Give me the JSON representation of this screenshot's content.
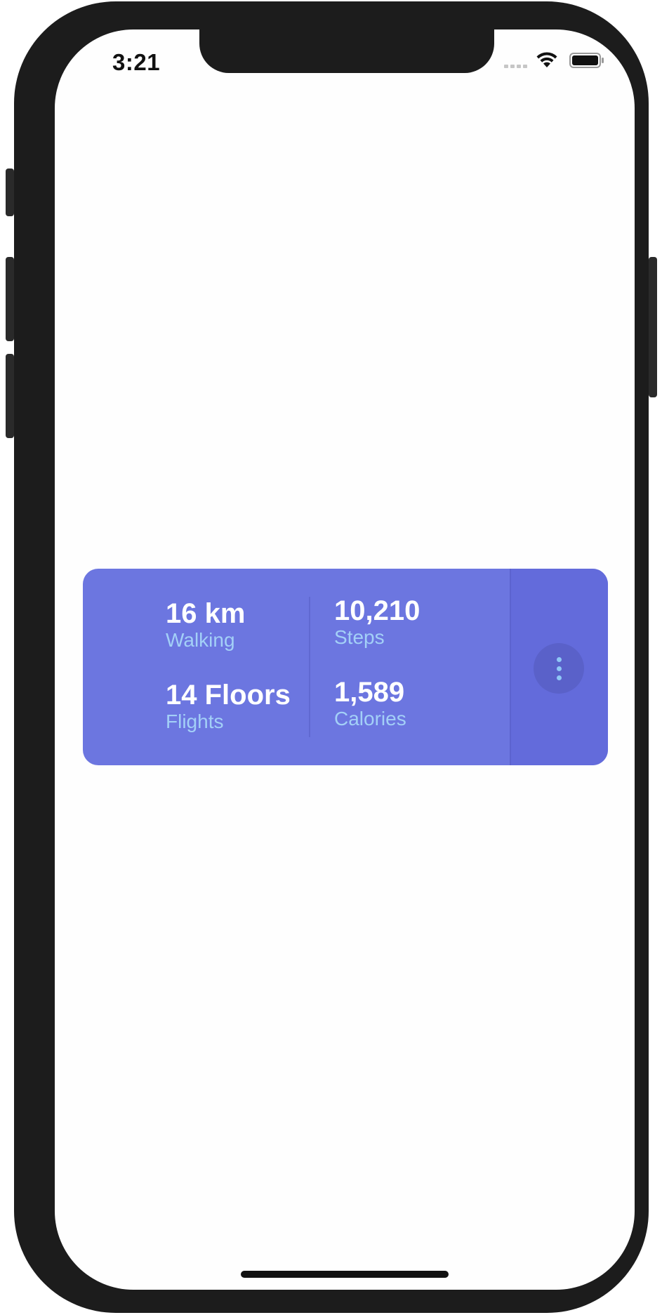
{
  "status_bar": {
    "time": "3:21",
    "signal_icon": "cellular-signal-icon",
    "wifi_icon": "wifi-icon",
    "battery_icon": "battery-icon"
  },
  "stats_card": {
    "colors": {
      "card_background": "#6c76e0",
      "side_background": "#636bdb",
      "value_text": "#ffffff",
      "label_text": "#a3d0f7"
    },
    "stats": [
      {
        "value": "16 km",
        "label": "Walking"
      },
      {
        "value": "10,210",
        "label": "Steps"
      },
      {
        "value": "14 Floors",
        "label": "Flights"
      },
      {
        "value": "1,589",
        "label": "Calories"
      }
    ],
    "more_icon": "vertical-ellipsis-icon"
  }
}
